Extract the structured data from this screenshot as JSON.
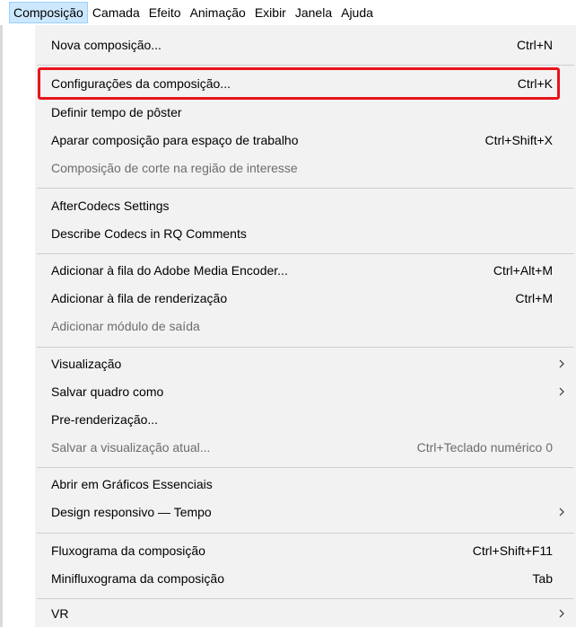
{
  "menubar": {
    "items": [
      {
        "label": "Composição",
        "active": true
      },
      {
        "label": "Camada"
      },
      {
        "label": "Efeito"
      },
      {
        "label": "Animação"
      },
      {
        "label": "Exibir"
      },
      {
        "label": "Janela"
      },
      {
        "label": "Ajuda"
      }
    ]
  },
  "menu": {
    "items": [
      {
        "label": "Nova composição...",
        "shortcut": "Ctrl+N"
      },
      {
        "label": "Configurações da composição...",
        "shortcut": "Ctrl+K",
        "highlighted": true
      },
      {
        "label": "Definir tempo de pôster",
        "shortcut": ""
      },
      {
        "label": "Aparar composição para espaço de trabalho",
        "shortcut": "Ctrl+Shift+X"
      },
      {
        "label": "Composição de corte na região de interesse",
        "shortcut": "",
        "disabled": true
      },
      {
        "label": "AfterCodecs Settings",
        "shortcut": ""
      },
      {
        "label": "Describe Codecs in RQ Comments",
        "shortcut": ""
      },
      {
        "label": "Adicionar à fila do Adobe Media Encoder...",
        "shortcut": "Ctrl+Alt+M"
      },
      {
        "label": "Adicionar à fila de renderização",
        "shortcut": "Ctrl+M"
      },
      {
        "label": "Adicionar módulo de saída",
        "shortcut": "",
        "disabled": true
      },
      {
        "label": "Visualização",
        "shortcut": "",
        "submenu": true
      },
      {
        "label": "Salvar quadro como",
        "shortcut": "",
        "submenu": true
      },
      {
        "label": "Pre-renderização...",
        "shortcut": ""
      },
      {
        "label": "Salvar a visualização atual...",
        "shortcut": "Ctrl+Teclado numérico 0",
        "disabled": true
      },
      {
        "label": "Abrir em Gráficos Essenciais",
        "shortcut": ""
      },
      {
        "label": "Design responsivo — Tempo",
        "shortcut": "",
        "submenu": true
      },
      {
        "label": "Fluxograma da composição",
        "shortcut": "Ctrl+Shift+F11"
      },
      {
        "label": "Minifluxograma da composição",
        "shortcut": "Tab"
      },
      {
        "label": "VR",
        "shortcut": "",
        "submenu": true
      }
    ]
  },
  "colors": {
    "menu_bg": "#f2f2f2",
    "active_menubar_bg": "#cce8ff",
    "highlight_border": "#e8141b",
    "disabled_text": "#6d6d6d"
  },
  "icons": {
    "submenu": "chevron-right-icon"
  }
}
